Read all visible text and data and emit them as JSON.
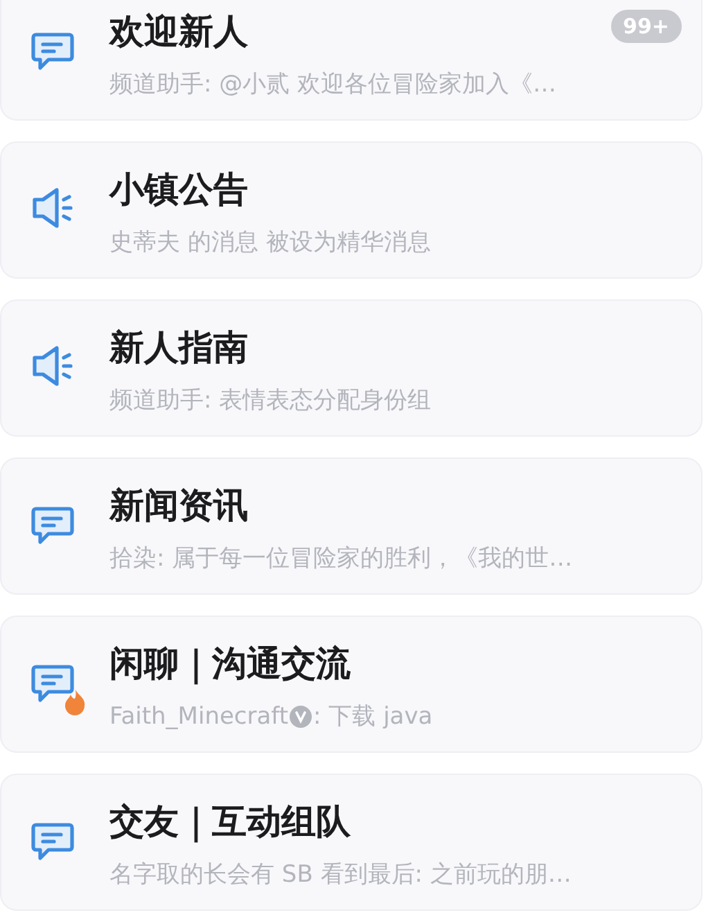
{
  "channels": [
    {
      "name": "欢迎新人",
      "kind": "chat",
      "hot": false,
      "badge": "99+",
      "preview": "频道助手: @小贰 欢迎各位冒险家加入《…"
    },
    {
      "name": "小镇公告",
      "kind": "announcement",
      "hot": false,
      "preview": "史蒂夫 的消息 被设为精华消息"
    },
    {
      "name": "新人指南",
      "kind": "announcement",
      "hot": false,
      "preview": "频道助手: 表情表态分配身份组"
    },
    {
      "name": "新闻资讯",
      "kind": "chat",
      "hot": false,
      "preview": "拾染: 属于每一位冒险家的胜利，《我的世…"
    },
    {
      "name": "闲聊｜沟通交流",
      "kind": "chat",
      "hot": true,
      "sender": "Faith_Minecraft",
      "verified": true,
      "preview": ": 下载 java"
    },
    {
      "name": "交友｜互动组队",
      "kind": "chat",
      "hot": false,
      "preview": "名字取的长会有 SB 看到最后: 之前玩的朋…"
    }
  ]
}
